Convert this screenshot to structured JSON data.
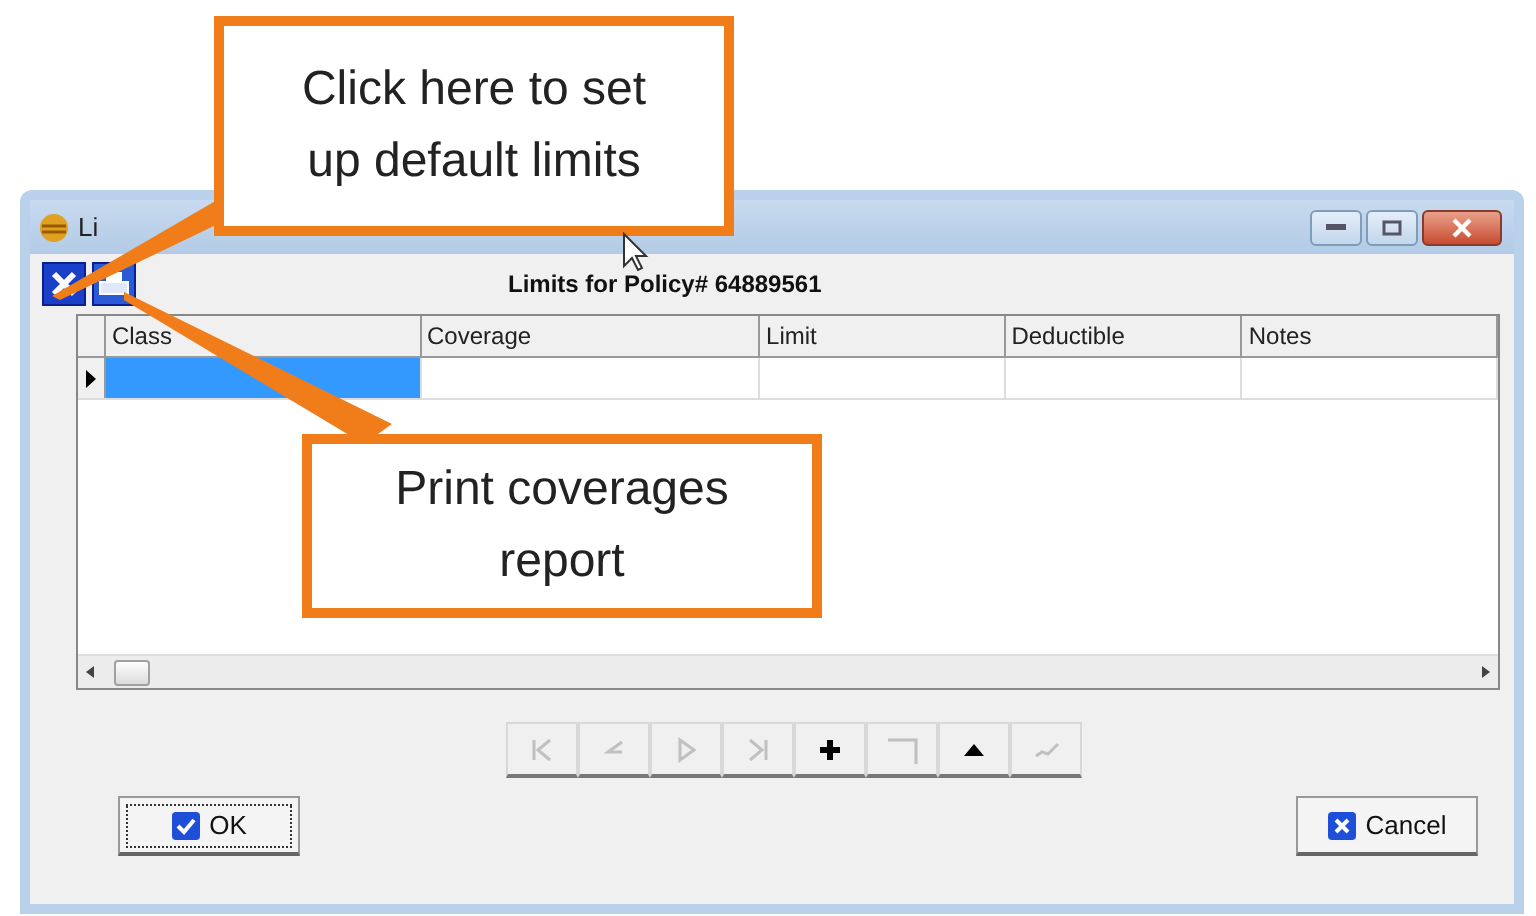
{
  "window": {
    "title": "Li"
  },
  "heading": "Limits for Policy# 64889561",
  "table": {
    "columns": [
      "Class",
      "Coverage",
      "Limit",
      "Deductible",
      "Notes"
    ],
    "rows": [
      {
        "current": true
      }
    ]
  },
  "nav_buttons": [
    {
      "kind": "first",
      "disabled": true
    },
    {
      "kind": "prior",
      "disabled": true
    },
    {
      "kind": "next",
      "disabled": true
    },
    {
      "kind": "last",
      "disabled": true
    },
    {
      "kind": "insert",
      "disabled": false
    },
    {
      "kind": "delete",
      "disabled": true
    },
    {
      "kind": "edit",
      "disabled": false
    },
    {
      "kind": "post",
      "disabled": true
    }
  ],
  "buttons": [
    {
      "kind": "ok",
      "label": "OK",
      "focused": true
    },
    {
      "kind": "cancel",
      "label": "Cancel",
      "focused": false
    }
  ],
  "callouts": [
    {
      "text": "Click here to set up default limits"
    },
    {
      "text": "Print coverages report"
    }
  ]
}
